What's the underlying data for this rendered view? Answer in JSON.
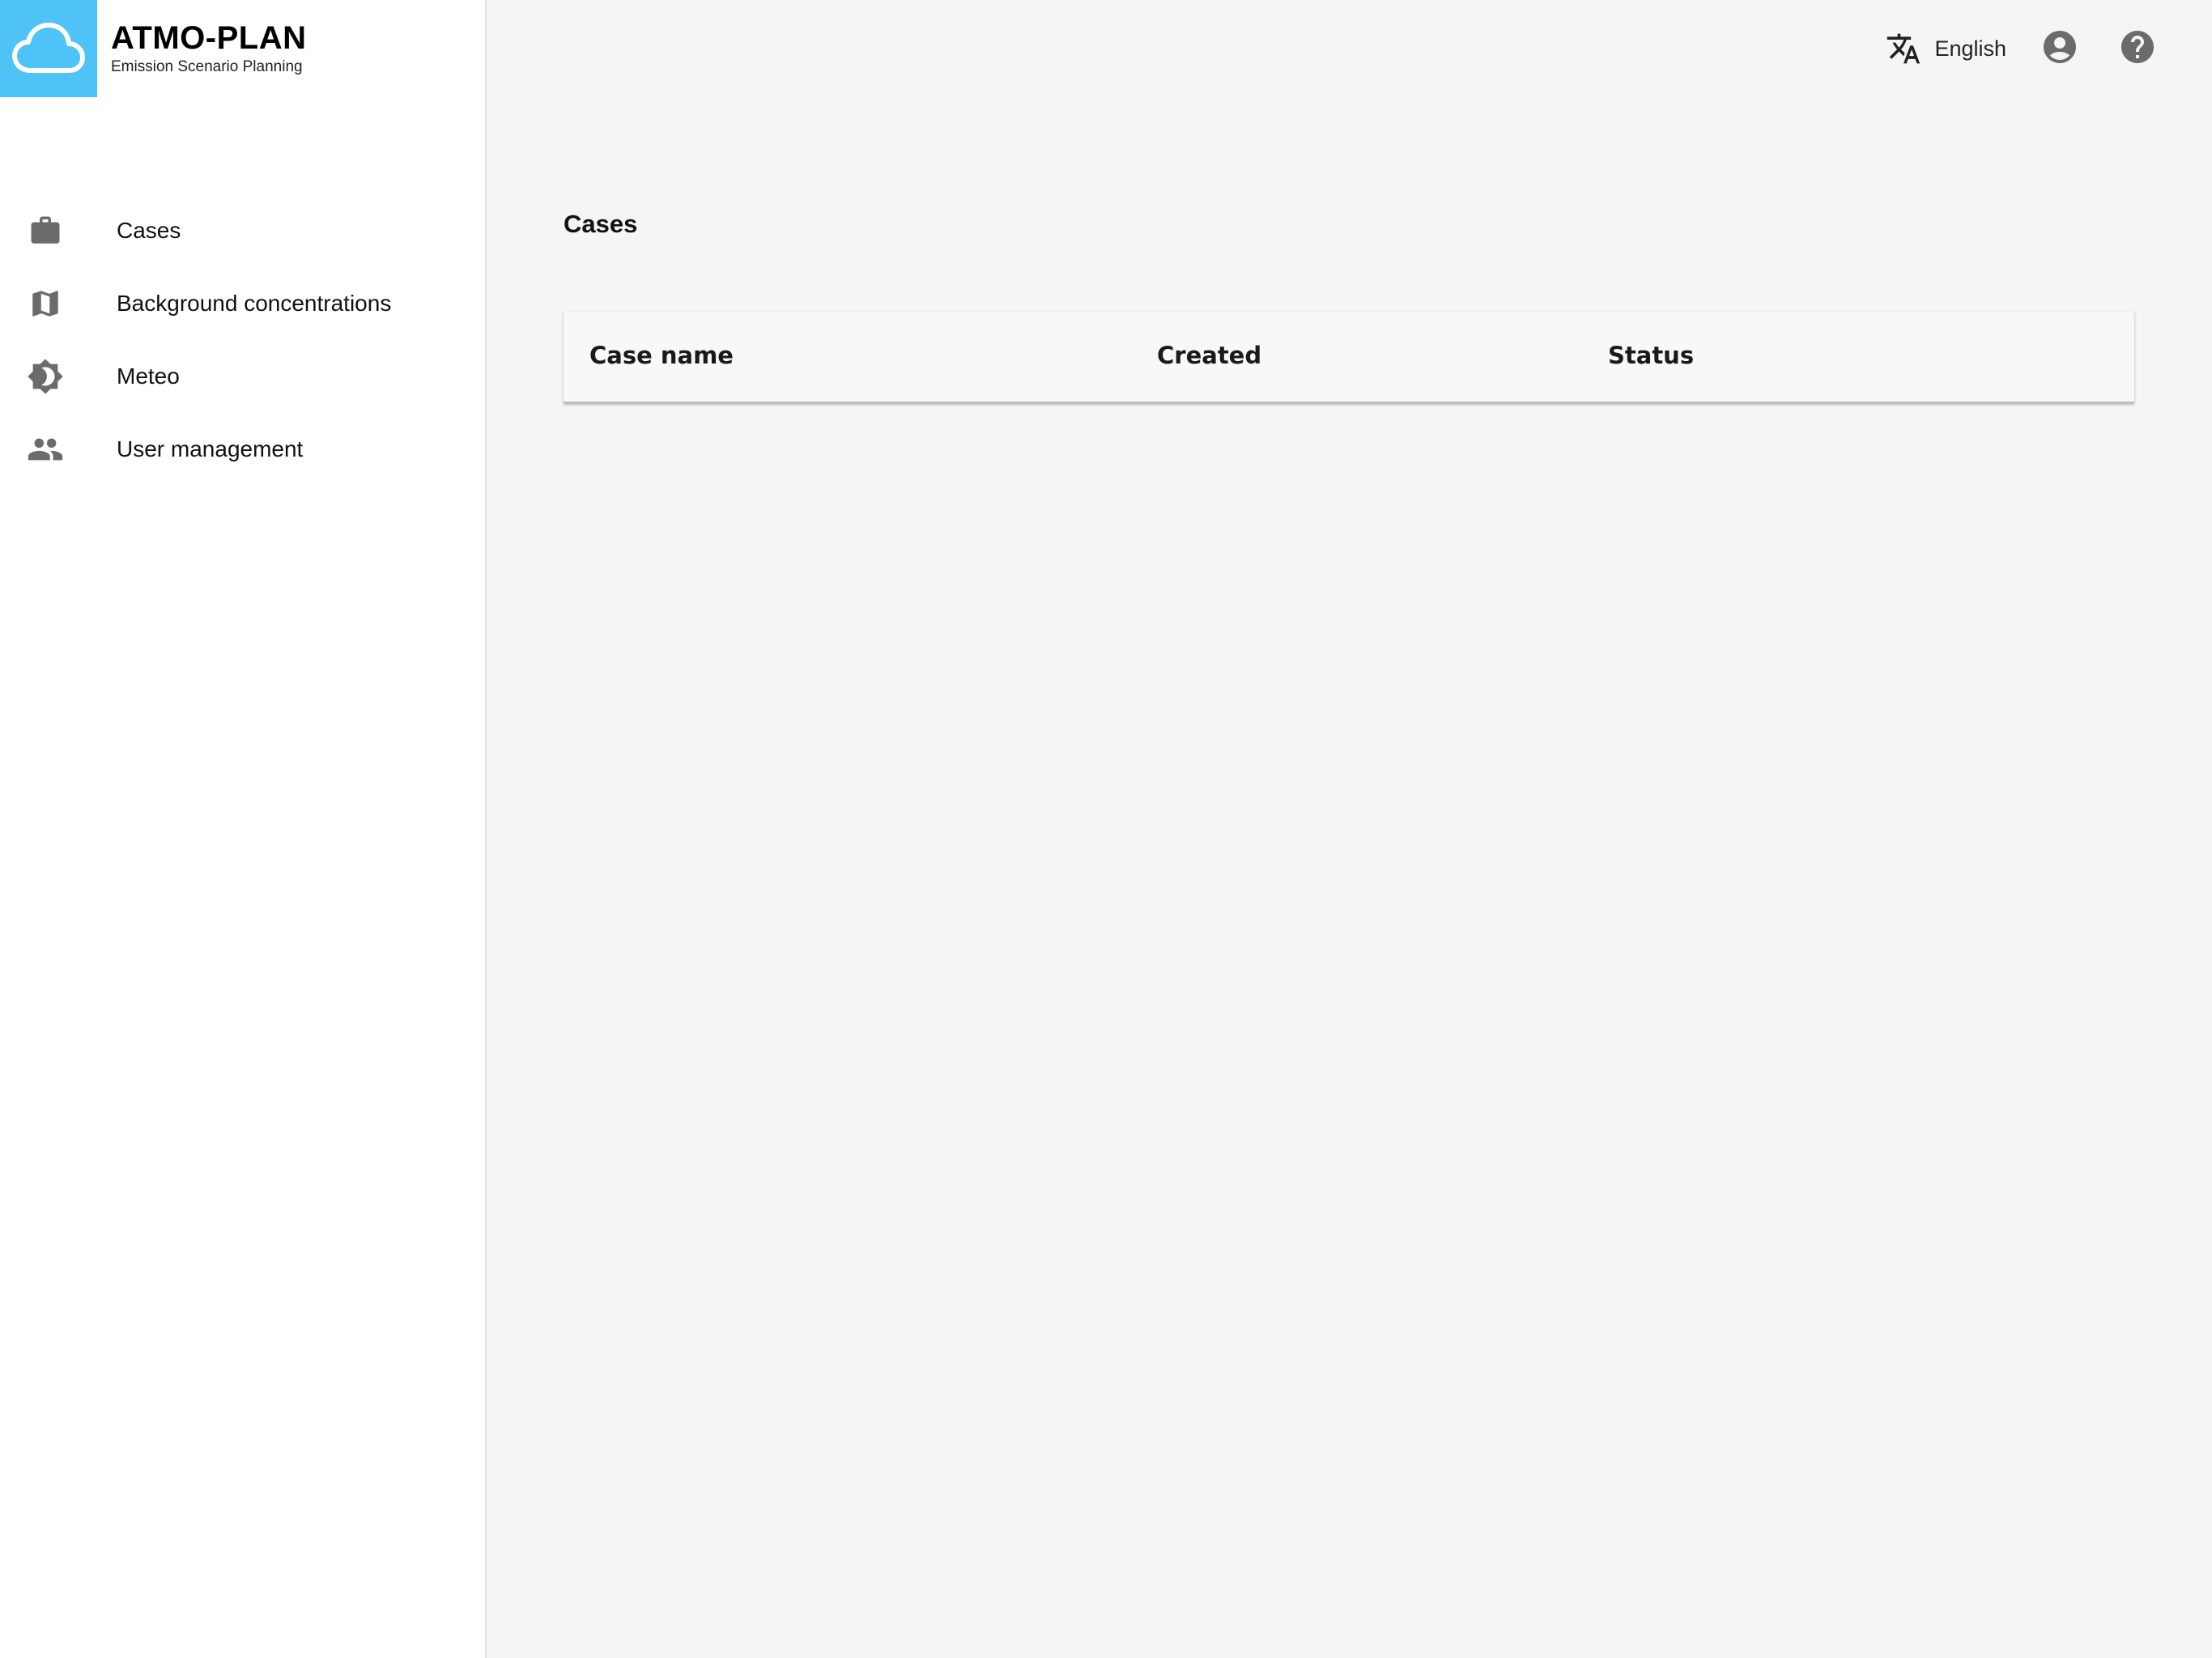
{
  "app": {
    "title": "ATMO-PLAN",
    "subtitle": "Emission Scenario Planning",
    "brand_color": "#4fc3f7"
  },
  "sidebar": {
    "items": [
      {
        "label": "Cases",
        "icon": "briefcase-icon"
      },
      {
        "label": "Background concentrations",
        "icon": "map-icon"
      },
      {
        "label": "Meteo",
        "icon": "brightness-icon"
      },
      {
        "label": "User management",
        "icon": "people-icon"
      }
    ]
  },
  "topbar": {
    "language": "English",
    "language_icon": "translate-icon",
    "account_icon": "account-circle-icon",
    "help_icon": "help-circle-icon"
  },
  "main": {
    "title": "Cases",
    "table": {
      "columns": [
        "Case name",
        "Created",
        "Status"
      ],
      "rows": []
    }
  }
}
